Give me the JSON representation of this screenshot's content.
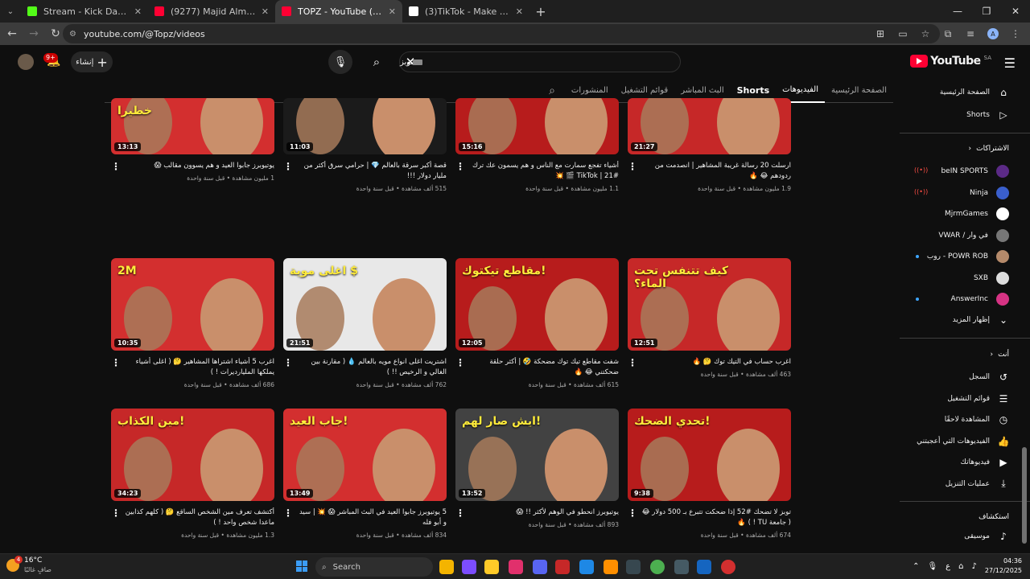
{
  "browser": {
    "tabs": [
      {
        "title": "Stream - Kick Dashboard",
        "color": "#53fc18",
        "active": false
      },
      {
        "title": "(9277) Majid Almohandis - Ge",
        "color": "#ff0033",
        "active": false
      },
      {
        "title": "TOPZ - YouTube تويز (9277)",
        "color": "#ff0033",
        "active": true
      },
      {
        "title": "(3)TikTok - Make Your Day",
        "color": "#ffffff",
        "active": false
      }
    ],
    "url": "youtube.com/@Topz/videos",
    "profile_initial": "A"
  },
  "masthead": {
    "logo_text": "YouTube",
    "country": "SA",
    "search_value": "توبز",
    "create_label": "إنشاء",
    "notifications": "9+"
  },
  "channel_tabs": [
    "الصفحة الرئيسية",
    "الفيديوهات",
    "Shorts",
    "البث المباشر",
    "قوائم التشغيل",
    "المنشورات"
  ],
  "sidebar": {
    "main": [
      {
        "label": "الصفحة الرئيسية",
        "icon": "home-icon"
      },
      {
        "label": "Shorts",
        "icon": "shorts-icon"
      }
    ],
    "subscriptions_header": "الاشتراكات",
    "subscriptions": [
      {
        "label": "beIN SPORTS",
        "color": "#5b2a86",
        "status": "live"
      },
      {
        "label": "Ninja",
        "color": "#3a5fcd",
        "status": "live"
      },
      {
        "label": "MjrmGames",
        "color": "#ffffff",
        "status": ""
      },
      {
        "label": "في وار / VWAR",
        "color": "#777777",
        "status": ""
      },
      {
        "label": "POWR ROB - روب",
        "color": "#b58a6a",
        "status": "new"
      },
      {
        "label": "SXB",
        "color": "#dddddd",
        "status": ""
      },
      {
        "label": "AnswerInc",
        "color": "#d63384",
        "status": "new"
      }
    ],
    "show_more": "إظهار المزيد",
    "you_header": "أنت",
    "you_items": [
      {
        "label": "السجل",
        "icon": "history-icon"
      },
      {
        "label": "قوائم التشغيل",
        "icon": "playlist-icon"
      },
      {
        "label": "المشاهدة لاحقًا",
        "icon": "clock-icon"
      },
      {
        "label": "الفيديوهات التي أعجبتني",
        "icon": "like-icon"
      },
      {
        "label": "فيديوهاتك",
        "icon": "your-videos-icon"
      },
      {
        "label": "عمليات التنزيل",
        "icon": "download-icon"
      }
    ],
    "explore_header": "استكشاف",
    "explore_items": [
      {
        "label": "موسيقى",
        "icon": "music-icon"
      }
    ]
  },
  "videos": [
    {
      "title": "ارسلت 20 رسالة غريبة المشاهير | انصدمت من ردودهم 😂 🔥",
      "stats": "1.9 مليون مشاهدة • قبل سنة واحدة",
      "duration": "21:27",
      "bg": "#c62828",
      "overlay": ""
    },
    {
      "title": "أشياء تفجع سمارت مع الناس و هم يسمون عك ترك #21 | TikTok 🎬 💥",
      "stats": "1.1 مليون مشاهدة • قبل سنة واحدة",
      "duration": "15:16",
      "bg": "#b71c1c",
      "overlay": ""
    },
    {
      "title": "قصة أكبر سرقة بالعالم 💎 | حرامي سرق أكثر من مليار دولار !!!",
      "stats": "515 ألف مشاهدة • قبل سنة واحدة",
      "duration": "11:03",
      "bg": "#1b1b1b",
      "overlay": ""
    },
    {
      "title": "يوتيوبرز جابوا العيد و هم يسوون مقالب 😱",
      "stats": "1 مليون مشاهدة • قبل سنة واحدة",
      "duration": "13:13",
      "bg": "#d32f2f",
      "overlay": "خطيرا"
    },
    {
      "title": "اغرب حساب في التيك توك 🤔 🔥",
      "stats": "463 ألف مشاهدة • قبل سنة واحدة",
      "duration": "12:51",
      "bg": "#c62828",
      "overlay": "كيف تتنفس تحت الماء؟"
    },
    {
      "title": "شفت مقاطع تيك توك مضحكة 🤣 | أكثر حلقة ضحكتني 😂 🔥",
      "stats": "615 ألف مشاهدة • قبل سنة واحدة",
      "duration": "12:05",
      "bg": "#b71c1c",
      "overlay": "مقاطع تيكتوك!"
    },
    {
      "title": "اشتريت اغلى انواع مويه بالعالم 💧 ( مقارنة بين الغالي و الرخيص !! )",
      "stats": "762 ألف مشاهدة • قبل سنة واحدة",
      "duration": "21:51",
      "bg": "#e8e8e8",
      "overlay": "اغلى موية $"
    },
    {
      "title": "اغرب 5 أشياء اشتراها المشاهير 🤔 ( اغلى أشياء يملكها المليارديرات ! )",
      "stats": "686 ألف مشاهدة • قبل سنة واحدة",
      "duration": "10:35",
      "bg": "#d32f2f",
      "overlay": "2M"
    },
    {
      "title": "توبز لا تضحك #52 إذا ضحكت تتبرع بـ 500 دولار 😂 ( جامعة TU ! ) 🔥",
      "stats": "674 ألف مشاهدة • قبل سنة واحدة",
      "duration": "9:38",
      "bg": "#b71c1c",
      "overlay": "تحدي الضحك!"
    },
    {
      "title": "يوتيوبرز انحطو في الوهم لأكثر !! 😱",
      "stats": "893 ألف مشاهدة • قبل سنة واحدة",
      "duration": "13:52",
      "bg": "#424242",
      "overlay": "ايش صار لهم!"
    },
    {
      "title": "5 يوتيوبرز جابوا العيد في البث المباشر 😱 💥 | سيد و أبو فله",
      "stats": "834 ألف مشاهدة • قبل سنة واحدة",
      "duration": "13:49",
      "bg": "#d32f2f",
      "overlay": "جاب العيد!"
    },
    {
      "title": "أكتشف تعرف مين الشخص الساقع 🤔 ( كلهم كذابين ماعدا شخص واحد ! )",
      "stats": "1.3 مليون مشاهدة • قبل سنة واحدة",
      "duration": "34:23",
      "bg": "#c62828",
      "overlay": "مين الكذاب!"
    }
  ],
  "taskbar": {
    "temperature": "16°C",
    "weather_desc": "صافٍ غالبًا",
    "weather_badge": "4",
    "search_label": "Search",
    "lang": "ع",
    "time": "04:36",
    "date": "27/12/2025"
  }
}
